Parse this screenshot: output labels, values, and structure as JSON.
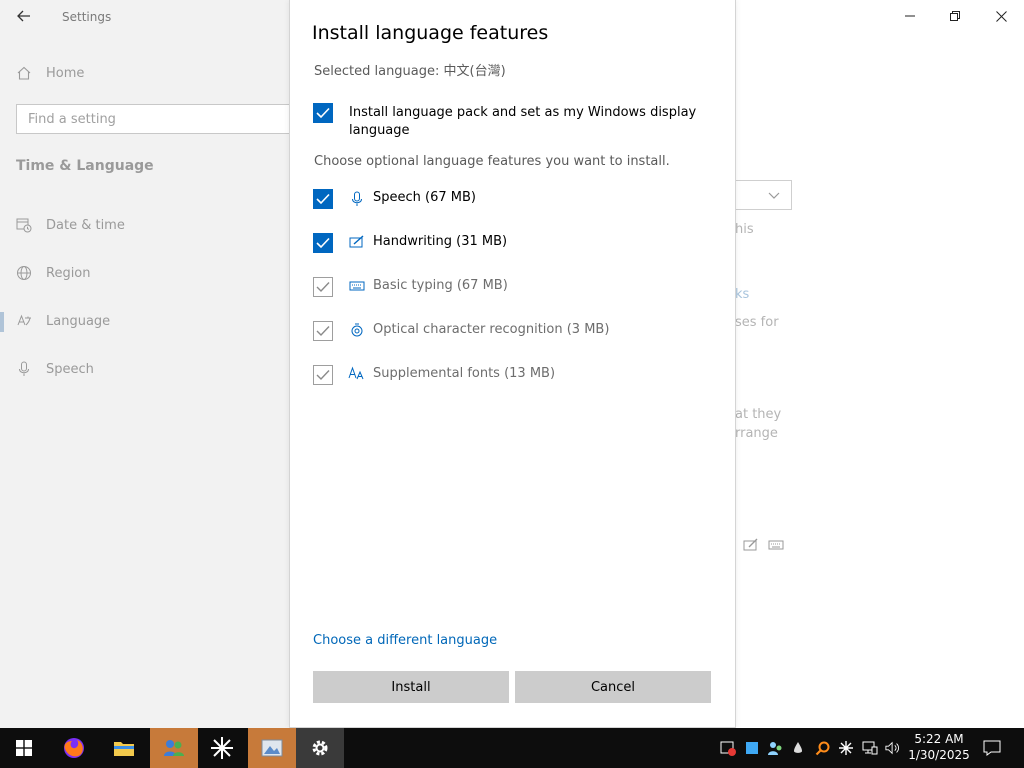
{
  "settings": {
    "app_title": "Settings",
    "home_label": "Home",
    "search_placeholder": "Find a setting",
    "section_title": "Time & Language",
    "nav": [
      {
        "label": "Date & time"
      },
      {
        "label": "Region"
      },
      {
        "label": "Language"
      },
      {
        "label": "Speech"
      }
    ],
    "background_fragments": {
      "text_1": "his",
      "link_1": "ks",
      "text_2": "ses for",
      "text_3": "at they",
      "text_4": "rrange"
    }
  },
  "dialog": {
    "title": "Install language features",
    "selected_language": "Selected language: 中文(台灣)",
    "main_option": {
      "label": "Install language pack and set as my Windows display language",
      "checked": true
    },
    "optional_label": "Choose optional language features you want to install.",
    "features": [
      {
        "label": "Speech (67 MB)",
        "icon": "microphone-icon",
        "checked": true,
        "enabled": true
      },
      {
        "label": "Handwriting (31 MB)",
        "icon": "pen-icon",
        "checked": true,
        "enabled": true
      },
      {
        "label": "Basic typing (67 MB)",
        "icon": "keyboard-icon",
        "checked": true,
        "enabled": false
      },
      {
        "label": "Optical character recognition (3 MB)",
        "icon": "ocr-icon",
        "checked": true,
        "enabled": false
      },
      {
        "label": "Supplemental fonts (13 MB)",
        "icon": "font-icon",
        "checked": true,
        "enabled": false
      }
    ],
    "choose_different_language": "Choose a different language",
    "install_label": "Install",
    "cancel_label": "Cancel"
  },
  "taskbar": {
    "time": "5:22 AM",
    "date": "1/30/2025"
  },
  "colors": {
    "accent": "#0067c0",
    "link": "#0067b8",
    "button": "#cccccc",
    "taskbar": "#0d0d0d"
  }
}
